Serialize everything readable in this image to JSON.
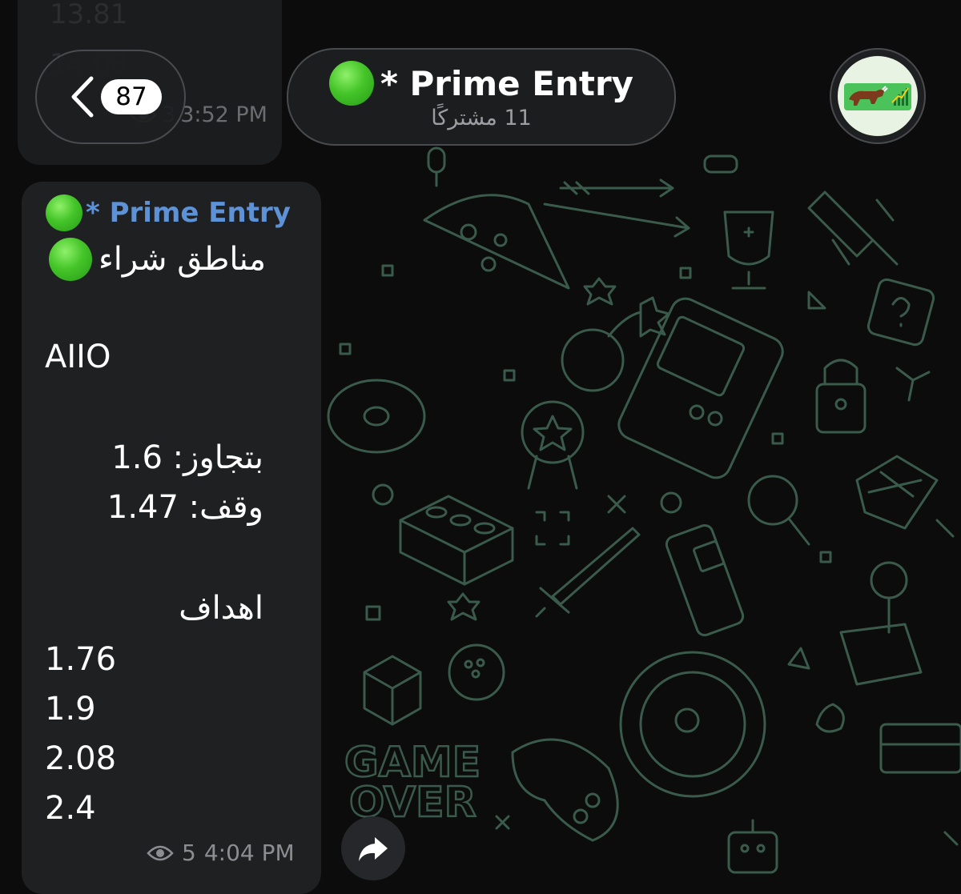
{
  "prev_message": {
    "faded_line_1": "13.81",
    "faded_line_2": "14.08",
    "views": "3",
    "time": "3:52 PM"
  },
  "header": {
    "back_count": "87",
    "title": "* Prime Entry",
    "subtitle": "11 مشتركًا",
    "avatar": "channel-avatar-bull-chart"
  },
  "wallpaper": {
    "game_over_line_1": "GAME",
    "game_over_line_2": "OVER"
  },
  "message": {
    "sender": "* Prime Entry",
    "heading": "مناطق شراء",
    "ticker": "AIIO",
    "entry_label": "بتجاوز:",
    "entry_value": "1.6",
    "stop_label": "وقف:",
    "stop_value": "1.47",
    "targets_label": "اهداف",
    "targets": [
      "1.76",
      "1.9",
      "2.08",
      "2.4"
    ],
    "views": "5",
    "time": "4:04 PM"
  },
  "colors": {
    "background": "#0b0c0b",
    "bubble": "#1f2022",
    "sender_name": "#5d92d6",
    "status_dot": "#45c529",
    "doodle": "#3a5a4c"
  }
}
